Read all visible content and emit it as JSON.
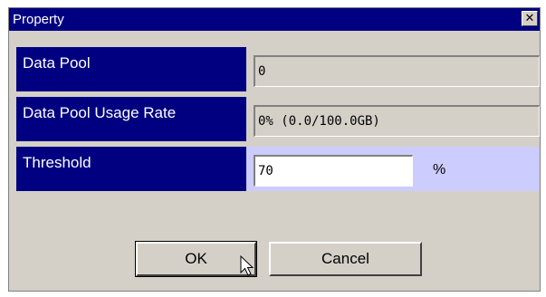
{
  "window": {
    "title": "Property",
    "close_glyph": "✕"
  },
  "fields": {
    "data_pool": {
      "label": "Data Pool",
      "value": "0"
    },
    "usage_rate": {
      "label": "Data Pool Usage Rate",
      "value": "0% (0.0/100.0GB)"
    },
    "threshold": {
      "label": "Threshold",
      "value": "70",
      "unit": "%"
    }
  },
  "buttons": {
    "ok": "OK",
    "cancel": "Cancel"
  },
  "colors": {
    "titlebar": "#000080",
    "label_bg": "#000080",
    "dialog_bg": "#d4d0c8",
    "highlight_row": "#ccccff"
  },
  "icons": {
    "cursor": "mouse-pointer-icon"
  }
}
